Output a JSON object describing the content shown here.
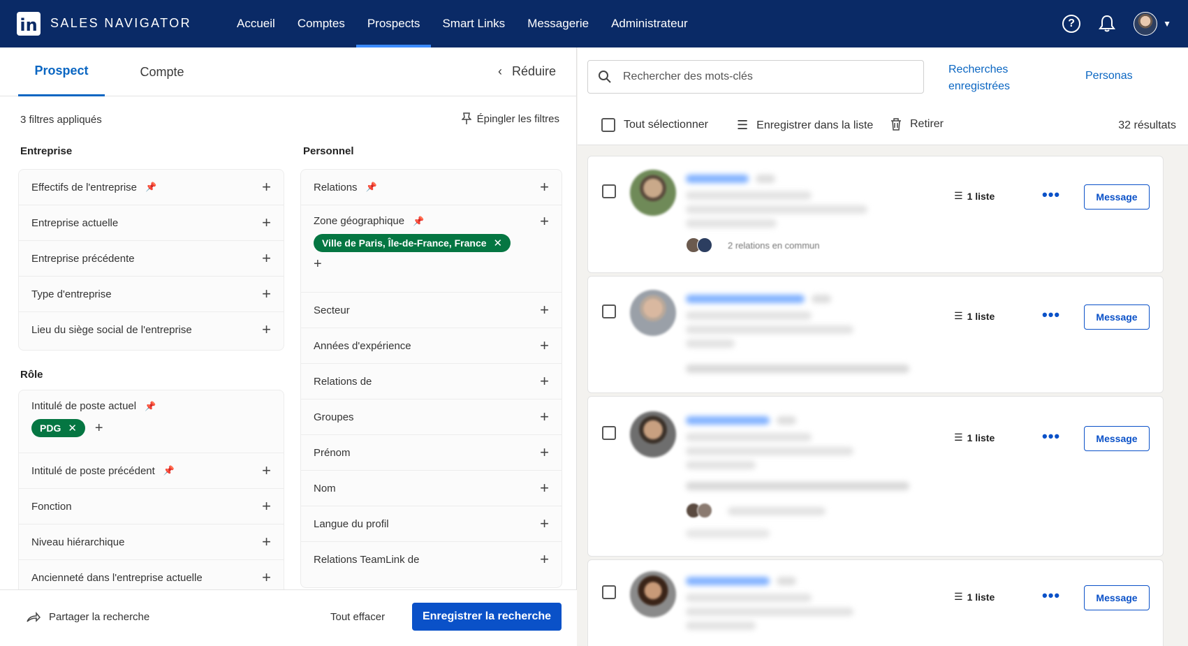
{
  "nav": {
    "brand": "SALES NAVIGATOR",
    "logo": "in",
    "links": [
      "Accueil",
      "Comptes",
      "Prospects",
      "Smart Links",
      "Messagerie",
      "Administrateur"
    ],
    "active": "Prospects"
  },
  "left": {
    "tabs": [
      "Prospect",
      "Compte"
    ],
    "collapse_label": "Réduire",
    "filters_applied": "3 filtres appliqués",
    "pin_filters": "Épingler les filtres",
    "sections": {
      "company_title": "Entreprise",
      "company": [
        "Effectifs de l'entreprise",
        "Entreprise actuelle",
        "Entreprise précédente",
        "Type d'entreprise",
        "Lieu du siège social de l'entreprise"
      ],
      "role_title": "Rôle",
      "role_current": "Intitulé de poste actuel",
      "role_current_pill": "PDG",
      "role": [
        "Intitulé de poste précédent",
        "Fonction",
        "Niveau hiérarchique",
        "Ancienneté dans l'entreprise actuelle"
      ],
      "personal_title": "Personnel",
      "personal_relations": "Relations",
      "geo": "Zone géographique",
      "geo_pill": "Ville de Paris, Île-de-France, France",
      "personal": [
        "Secteur",
        "Années d'expérience",
        "Relations de",
        "Groupes",
        "Prénom",
        "Nom",
        "Langue du profil",
        "Relations TeamLink de"
      ]
    },
    "footer": {
      "share": "Partager la recherche",
      "clear": "Tout effacer",
      "save": "Enregistrer la recherche"
    }
  },
  "right": {
    "search_placeholder": "Rechercher des mots-clés",
    "saved_searches": "Recherches enregistrées",
    "personas": "Personas",
    "select_all": "Tout sélectionner",
    "save_to_list": "Enregistrer dans la liste",
    "remove": "Retirer",
    "results": "32 résultats",
    "cards": [
      {
        "list": "1 liste",
        "button": "Message",
        "common": "2 relations en commun"
      },
      {
        "list": "1 liste",
        "button": "Message"
      },
      {
        "list": "1 liste",
        "button": "Message"
      },
      {
        "list": "1 liste",
        "button": "Message"
      }
    ]
  },
  "colors": {
    "nav_bg": "#0a2a66",
    "accent": "#0a66c2",
    "pill_green": "#057642",
    "primary_button": "#0a51c8"
  }
}
